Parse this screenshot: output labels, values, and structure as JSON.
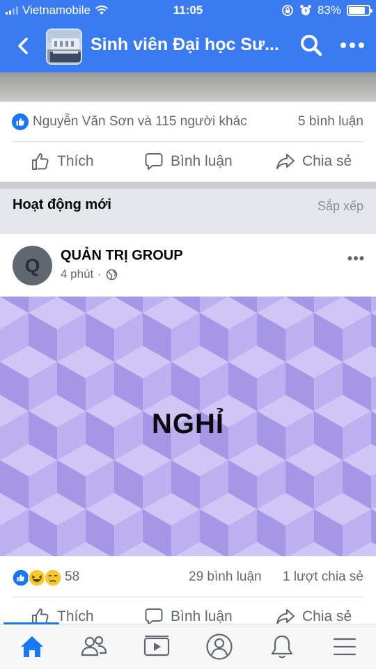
{
  "status_bar": {
    "carrier": "Vietnamobile",
    "time": "11:05",
    "battery": "83%",
    "battery_level": 0.83
  },
  "header": {
    "title": "Sinh viên Đại học Sư...",
    "back_icon": "chevron-left-icon",
    "search_icon": "search-icon",
    "more_icon": "more-horizontal-icon"
  },
  "previous_post": {
    "reactions_text": "Nguyễn Văn Sơn và 115 người khác",
    "comments": "5 bình luận",
    "actions": {
      "like": "Thích",
      "comment": "Bình luận",
      "share": "Chia sẻ"
    }
  },
  "recent_section": {
    "title": "Hoạt động mới",
    "sort": "Sắp xếp"
  },
  "post": {
    "avatar_letter": "Q",
    "author": "QUẢN TRỊ GROUP",
    "time": "4 phút",
    "separator": "·",
    "privacy_icon": "globe-icon",
    "text": "NGHỈ",
    "background_color": "#b7aaee",
    "reaction_count": "58",
    "comments": "29 bình luận",
    "shares": "1 lượt chia sẻ",
    "actions": {
      "like": "Thích",
      "comment": "Bình luận",
      "share": "Chia sẻ"
    }
  },
  "tabbar": {
    "tabs": [
      {
        "icon": "home-icon",
        "active": true
      },
      {
        "icon": "friends-icon",
        "active": false
      },
      {
        "icon": "video-icon",
        "active": false
      },
      {
        "icon": "profile-icon",
        "active": false
      },
      {
        "icon": "bell-icon",
        "active": false
      },
      {
        "icon": "menu-icon",
        "active": false
      }
    ],
    "accent": "#1877f2"
  },
  "colors": {
    "header_bg": "#3b7bf2",
    "facebook_blue": "#1877f2",
    "secondary_text": "#606770"
  }
}
